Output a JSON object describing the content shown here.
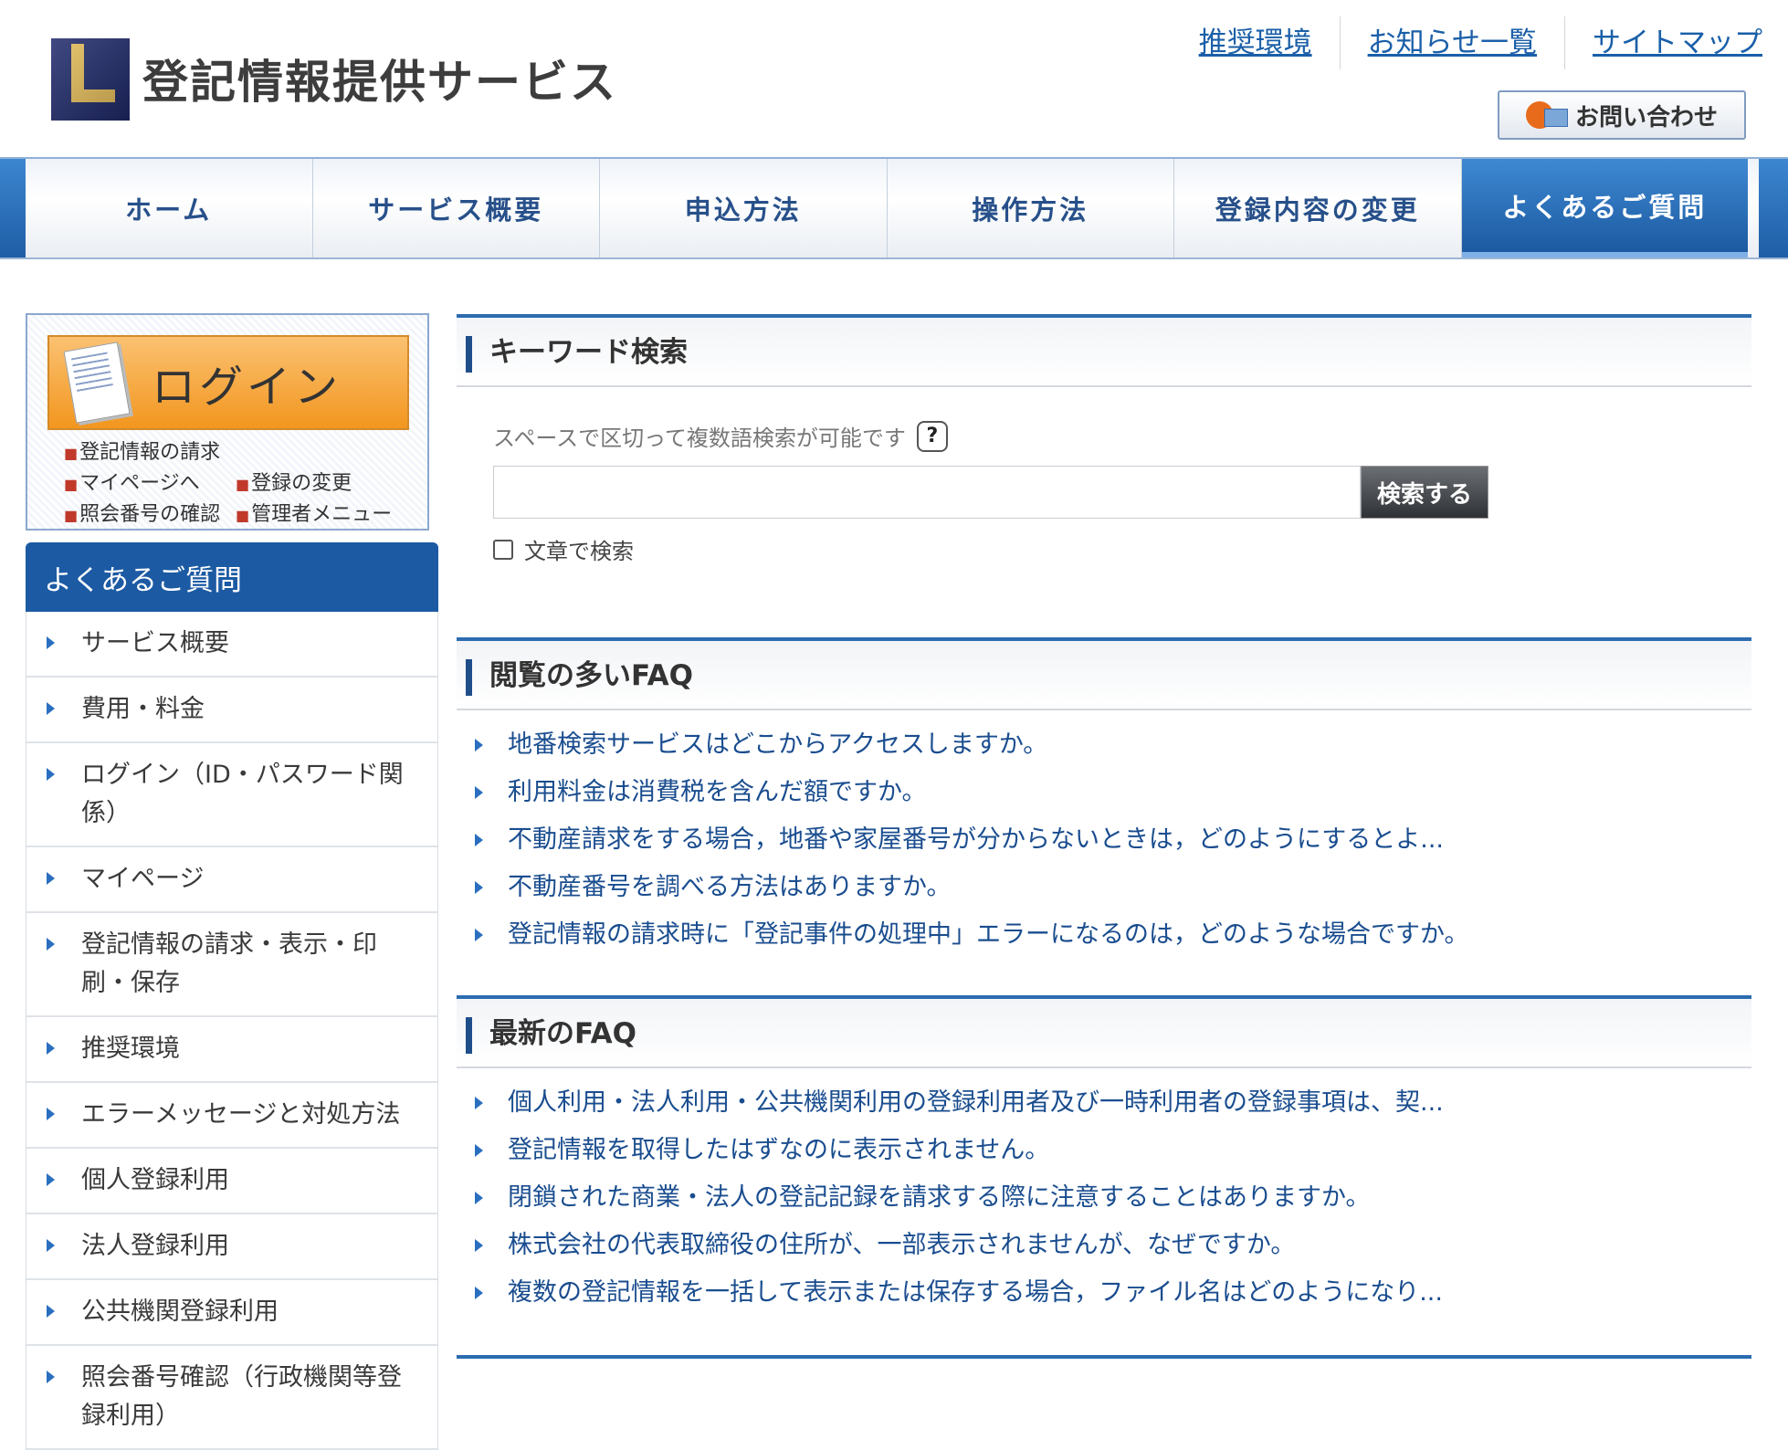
{
  "header": {
    "site_title": "登記情報提供サービス",
    "top_links": [
      "推奨環境",
      "お知らせ一覧",
      "サイトマップ"
    ],
    "contact_label": "お問い合わせ"
  },
  "nav": [
    "ホーム",
    "サービス概要",
    "申込方法",
    "操作方法",
    "登録内容の変更",
    "よくあるご質問"
  ],
  "login": {
    "label": "ログイン",
    "links": [
      "登記情報の請求",
      "マイページへ",
      "登録の変更",
      "照会番号の確認",
      "管理者メニュー"
    ]
  },
  "faq_sidebar": {
    "heading": "よくあるご質問",
    "items": [
      "サービス概要",
      "費用・料金",
      "ログイン（ID・パスワード関係）",
      "マイページ",
      "登記情報の請求・表示・印刷・保存",
      "推奨環境",
      "エラーメッセージと対処方法",
      "個人登録利用",
      "法人登録利用",
      "公共機関登録利用",
      "照会番号確認（行政機関等登録利用）"
    ]
  },
  "search": {
    "heading": "キーワード検索",
    "hint": "スペースで区切って複数語検索が可能です",
    "help": "?",
    "input_value": "",
    "button": "検索する",
    "fulltext_label": "文章で検索"
  },
  "popular": {
    "heading": "閲覧の多いFAQ",
    "items": [
      "地番検索サービスはどこからアクセスしますか。",
      "利用料金は消費税を含んだ額ですか。",
      "不動産請求をする場合，地番や家屋番号が分からないときは，どのようにするとよ...",
      "不動産番号を調べる方法はありますか。",
      "登記情報の請求時に「登記事件の処理中」エラーになるのは，どのような場合ですか。"
    ]
  },
  "latest": {
    "heading": "最新のFAQ",
    "items": [
      "個人利用・法人利用・公共機関利用の登録利用者及び一時利用者の登録事項は、契...",
      "登記情報を取得したはずなのに表示されません。",
      "閉鎖された商業・法人の登記記録を請求する際に注意することはありますか。",
      "株式会社の代表取締役の住所が、一部表示されませんが、なぜですか。",
      "複数の登記情報を一括して表示または保存する場合，ファイル名はどのようになり..."
    ]
  }
}
